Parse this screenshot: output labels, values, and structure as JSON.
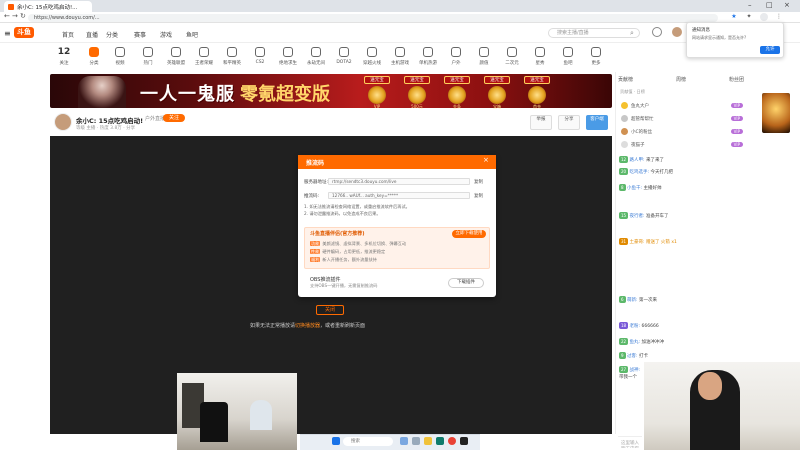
{
  "browser": {
    "tab_title": "余小C: 15点吃鸡启动!...",
    "url": "https://www.douyu.com/...",
    "nav": {
      "back": "←",
      "forward": "→",
      "refresh": "↻"
    }
  },
  "header": {
    "logo": "斗鱼",
    "nav": [
      "首页",
      "直播",
      "分类",
      "赛事",
      "游戏",
      "鱼吧"
    ],
    "search_placeholder": "搜索主播/直播"
  },
  "categories": {
    "first_count": "12",
    "first_label": "关注",
    "items": [
      "分类",
      "视频",
      "热门",
      "英雄联盟",
      "王者荣耀",
      "和平精英",
      "CS2",
      "绝地求生",
      "永劫无间",
      "DOTA2",
      "穿越火线",
      "主机游戏",
      "单机热游",
      "户外",
      "颜值",
      "二次元",
      "星秀",
      "鱼吧",
      "更多"
    ]
  },
  "banner": {
    "title": "一人一鬼服",
    "subtitle": "零氪超变版",
    "badges": [
      {
        "label": "送元宝",
        "text": "VIP"
      },
      {
        "label": "送元宝",
        "text": "500元"
      },
      {
        "label": "送元宝",
        "text": "金条"
      },
      {
        "label": "送元宝",
        "text": "宝箱"
      },
      {
        "label": "送元宝",
        "text": "首充"
      }
    ]
  },
  "stream": {
    "title": "余小C: 15点吃鸡启动!",
    "tag": "户外直播",
    "follow": "关注",
    "meta": "等级 主播 · 热度 3.8万 · 分享",
    "btn_report": "举报",
    "btn_share": "分享",
    "btn_download": "客户端"
  },
  "player": {
    "close_label": "关闭",
    "note_prefix": "如果无法正常播放请",
    "note_link": "切换播放器",
    "note_suffix": "，或者重新刷新页面"
  },
  "dialog": {
    "title": "推流码",
    "server_label": "服务器地址:",
    "server_value": "rtmp://sendtc3.douyu.com/live",
    "copy1": "复制",
    "key_label": "推流码:",
    "key_value": "12766.. wAUf... auth_key=*****",
    "copy2": "复制",
    "tip1": "1. 如无法推流请检查网络设置，或重启推流软件后再试。",
    "tip2": "2. 请勿泄露推流码，以免造成不良后果。",
    "card_title": "斗鱼直播伴侣(官方推荐)",
    "card_btn": "立即下载使用",
    "card_lines": [
      {
        "tag": "功能",
        "text": "美颜滤镜、虚拟背景、多机位切换、弹幕互动"
      },
      {
        "tag": "性能",
        "text": "硬件编码，占用更低，推流更稳定"
      },
      {
        "tag": "福利",
        "text": "新人开播任务，额外流量扶持"
      }
    ],
    "bottom_title": "OBS推流插件",
    "bottom_sub": "支持OBS一键开播，无需复制推流码",
    "dl_btn": "下载插件",
    "close": "×"
  },
  "right_panel": {
    "tabs": [
      "贡献榜",
      "周榜",
      "粉丝团"
    ],
    "subtitle": "贡献值 · 日榜",
    "ranks": [
      {
        "name": "鱼丸大户",
        "pill": "VIP"
      },
      {
        "name": "超管帮帮忙",
        "pill": "VIP"
      },
      {
        "name": "小C的粉丝",
        "pill": "VIP"
      },
      {
        "name": "夜猫子",
        "pill": "VIP"
      }
    ],
    "chats": [
      {
        "lv": "12",
        "name": "路人甲:",
        "text": "来了来了",
        "gold": false
      },
      {
        "lv": "20",
        "name": "吃鸡选手:",
        "text": "今天打几把",
        "gold": false
      },
      {
        "lv": "8",
        "name": "小鱼干:",
        "text": "主播好帅",
        "gold": false
      },
      {
        "lv": "15",
        "name": "夜行者:",
        "text": "准备开车了",
        "gold": false
      },
      {
        "lv": "31",
        "name": "土豪哥:",
        "text": "赠送了 火箭 x1",
        "gold": true
      },
      {
        "lv": "6",
        "name": "萌新:",
        "text": "第一次来",
        "gold": false
      },
      {
        "lv": "18",
        "name": "老粉:",
        "text": "666666",
        "gold": false
      },
      {
        "lv": "22",
        "name": "鱼丸:",
        "text": "加油冲冲冲",
        "gold": false
      },
      {
        "lv": "9",
        "name": "过客:",
        "text": "打卡",
        "gold": false
      },
      {
        "lv": "27",
        "name": "战神:",
        "text": "带我一个",
        "gold": false
      }
    ],
    "input_placeholder": "这里输入聊天内容"
  },
  "toast": {
    "title": "通知消息",
    "message": "网站请求显示通知，是否允许?",
    "button": "允许"
  },
  "taskbar": {
    "search": "搜索"
  },
  "colors": {
    "brand": "#ff6a00",
    "player_bg": "#202020"
  }
}
